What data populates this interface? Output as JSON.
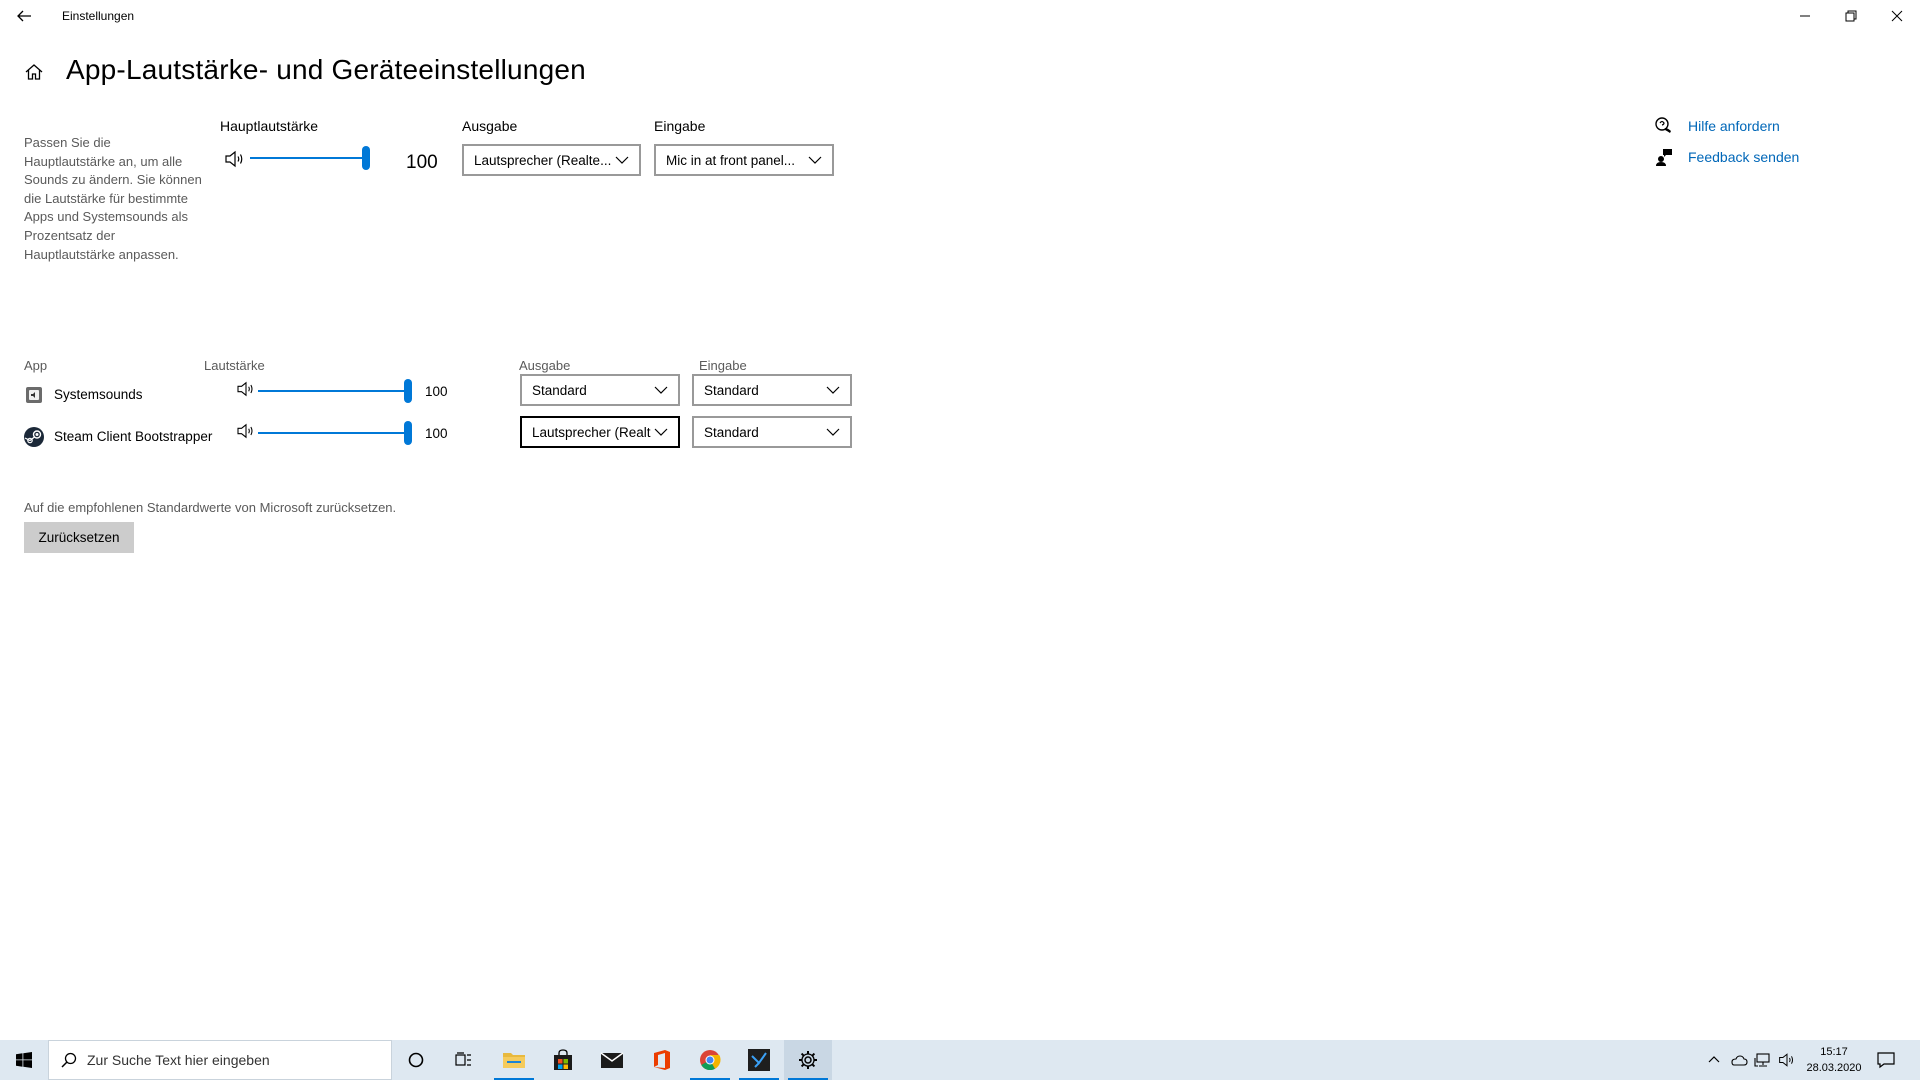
{
  "window": {
    "title": "Einstellungen"
  },
  "header": {
    "title": "App-Lautstärke- und Geräteeinstellungen"
  },
  "master": {
    "description": "Passen Sie die Hauptlautstärke an, um alle Sounds zu ändern. Sie können die Lautstärke für bestimmte Apps und Systemsounds als Prozentsatz der Hauptlautstärke anpassen.",
    "volume_label": "Hauptlautstärke",
    "volume_value": "100",
    "volume_level": 100,
    "output_label": "Ausgabe",
    "output_value": "Lautsprecher (Realte...",
    "input_label": "Eingabe",
    "input_value": "Mic in at front panel..."
  },
  "apps": {
    "col_app": "App",
    "col_volume": "Lautstärke",
    "col_output": "Ausgabe",
    "col_input": "Eingabe",
    "rows": [
      {
        "name": "Systemsounds",
        "icon": "system-sounds-icon",
        "volume": "100",
        "level": 100,
        "output": "Standard",
        "input": "Standard"
      },
      {
        "name": "Steam Client Bootstrapper",
        "icon": "steam-icon",
        "volume": "100",
        "level": 100,
        "output": "Lautsprecher (Realt",
        "input": "Standard"
      }
    ]
  },
  "reset": {
    "text": "Auf die empfohlenen Standardwerte von Microsoft zurücksetzen.",
    "button": "Zurücksetzen"
  },
  "help": {
    "get_help": "Hilfe anfordern",
    "feedback": "Feedback senden"
  },
  "taskbar": {
    "search_placeholder": "Zur Suche Text hier eingeben",
    "time": "15:17",
    "date": "28.03.2020"
  },
  "colors": {
    "accent": "#0078d7",
    "link": "#0067b8",
    "taskbar": "#dee8f1"
  }
}
